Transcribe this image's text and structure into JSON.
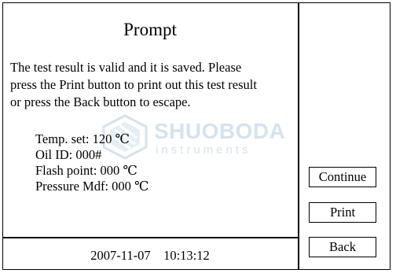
{
  "dialog": {
    "title": "Prompt",
    "message_lines": [
      "The test result is valid and it is saved. Please",
      "press the Print button to print out this test result",
      "or press the Back button to escape."
    ]
  },
  "params": {
    "temp_set": "Temp. set: 120 ℃",
    "oil_id": "Oil ID: 000#",
    "flash_point": "Flash point: 000 ℃",
    "pressure_mdf": "Pressure Mdf: 000 ℃"
  },
  "status": {
    "datetime": "2007-11-07    10:13:12"
  },
  "buttons": {
    "continue_label": "Continue",
    "print_label": "Print",
    "back_label": "Back"
  },
  "watermark": {
    "brand": "SHUOBODA",
    "sub": "instruments",
    "color": "#4a7fb8"
  }
}
